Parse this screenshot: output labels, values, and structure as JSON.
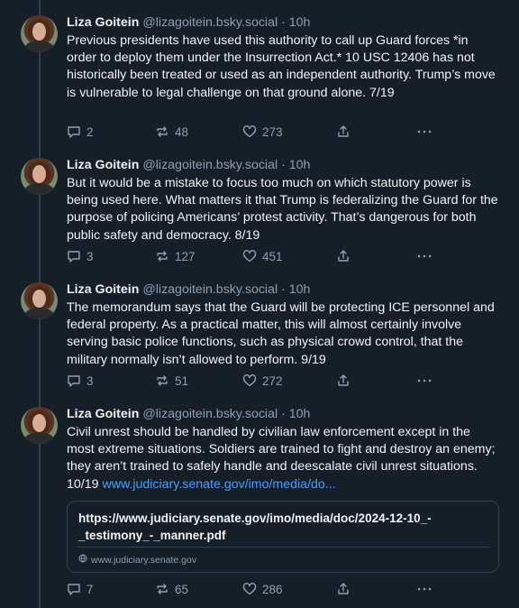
{
  "author": {
    "name": "Liza Goitein",
    "handle": "@lizagoitein.bsky.social",
    "separator": "·"
  },
  "posts": [
    {
      "time": "10h",
      "text": "Previous presidents have used this authority to call up Guard forces *in order to deploy them under the Insurrection Act.* 10 USC 12406 has not historically been treated or used as an independent authority. Trump’s move is vulnerable to legal challenge on that ground alone. 7/19",
      "replies": "2",
      "reposts": "48",
      "likes": "273"
    },
    {
      "time": "10h",
      "text": "But it would be a mistake to focus too much on which statutory power is being used here. What matters it that Trump is federalizing the Guard for the purpose of policing Americans’ protest activity. That’s dangerous for both public safety and democracy. 8/19",
      "replies": "3",
      "reposts": "127",
      "likes": "451"
    },
    {
      "time": "10h",
      "text": "The memorandum says that the Guard will be protecting ICE personnel and federal property. As a practical matter, this will almost certainly involve serving basic police functions, such as physical crowd control, that the military normally isn’t allowed to perform. 9/19",
      "replies": "3",
      "reposts": "51",
      "likes": "272"
    },
    {
      "time": "10h",
      "text": "Civil unrest should be handled by civilian law enforcement except in the most extreme situations. Soldiers are trained to fight and destroy an enemy; they aren’t trained to safely handle and deescalate civil unrest situations. 10/19 ",
      "link_text": "www.judiciary.senate.gov/imo/media/do...",
      "embed": {
        "title": "https://www.judiciary.senate.gov/imo/media/doc/2024-12-10_-_testimony_-_manner.pdf",
        "domain": "www.judiciary.senate.gov"
      },
      "replies": "7",
      "reposts": "65",
      "likes": "286"
    }
  ],
  "icons": {
    "reply": "speech-bubble-icon",
    "repost": "repost-arrows-icon",
    "like": "heart-icon",
    "share": "share-icon",
    "more": "ellipsis-icon",
    "globe": "globe-icon"
  },
  "colors": {
    "background": "#161e27",
    "text": "#f1f3f5",
    "muted": "#8c9fb3",
    "link": "#4a9eff",
    "border": "#2e4052"
  }
}
